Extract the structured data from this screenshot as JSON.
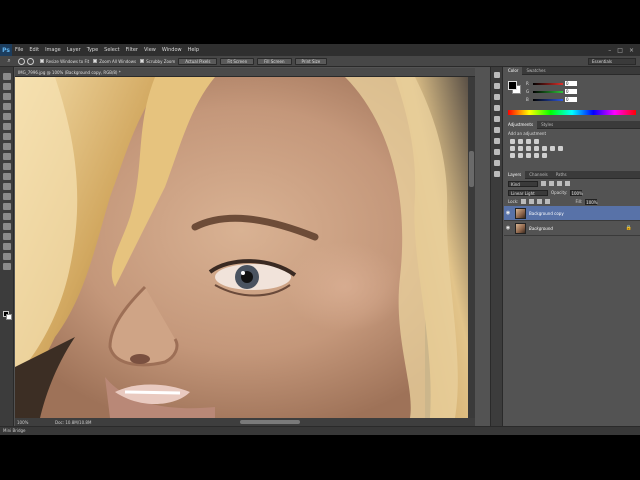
{
  "app": {
    "logo": "Ps",
    "menu": [
      "File",
      "Edit",
      "Image",
      "Layer",
      "Type",
      "Select",
      "Filter",
      "View",
      "Window",
      "Help"
    ],
    "window_controls": [
      "–",
      "□",
      "×"
    ]
  },
  "options_bar": {
    "resize_windows": "Resize Windows to Fit",
    "zoom_all": "Zoom All Windows",
    "scrubby_zoom": "Scrubby Zoom",
    "buttons": [
      "Actual Pixels",
      "Fit Screen",
      "Fill Screen",
      "Print Size"
    ],
    "workspace": "Essentials"
  },
  "document": {
    "tab_title": "IMG_7996.jpg @ 100% (Background copy, RGB/8) *",
    "zoom": "100%",
    "doc_size": "Doc: 10.8M/10.8M"
  },
  "status_bar": {
    "mini_bridge": "Mini Bridge"
  },
  "color_panel": {
    "tabs": [
      "Color",
      "Swatches"
    ],
    "sliders": [
      {
        "label": "R",
        "value": "0",
        "color": "#e0302a"
      },
      {
        "label": "G",
        "value": "0",
        "color": "#2fc33a"
      },
      {
        "label": "B",
        "value": "0",
        "color": "#2e57e0"
      }
    ]
  },
  "adjustments_panel": {
    "tabs": [
      "Adjustments",
      "Styles"
    ],
    "title": "Add an adjustment"
  },
  "layers_panel": {
    "tabs": [
      "Layers",
      "Channels",
      "Paths"
    ],
    "kind": "Kind",
    "blend_mode": "Linear Light",
    "opacity_label": "Opacity:",
    "opacity": "100%",
    "lock_label": "Lock:",
    "fill_label": "Fill:",
    "fill": "100%",
    "layers": [
      {
        "name": "Background copy",
        "selected": true
      },
      {
        "name": "Background",
        "selected": false
      }
    ],
    "lock_icon": "🔒"
  },
  "colors": {
    "accent_selection": "#5872a8",
    "fg_color": "#000000",
    "bg_color": "#ffffff"
  }
}
